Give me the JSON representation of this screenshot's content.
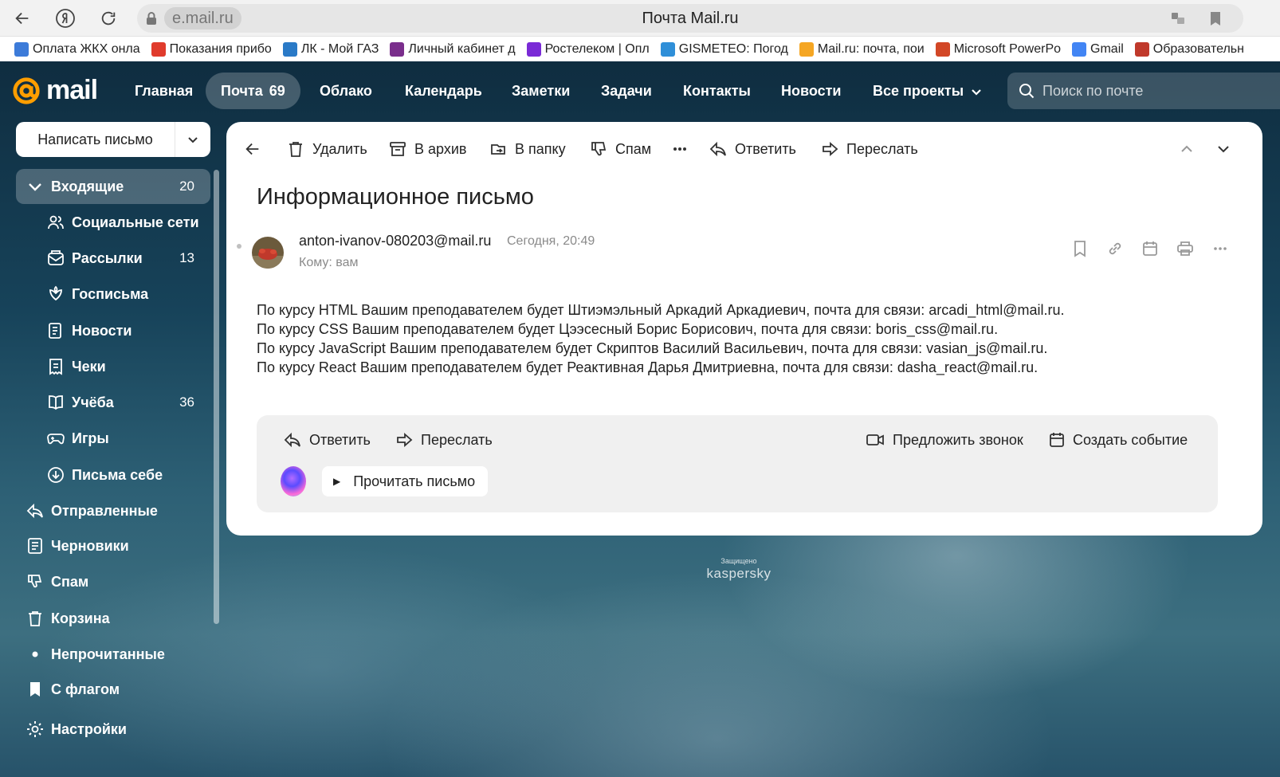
{
  "browser": {
    "url": "e.mail.ru",
    "tab_title": "Почта Mail.ru"
  },
  "bookmarks": [
    {
      "label": "Оплата ЖКХ онла",
      "color": "#3c7bd9"
    },
    {
      "label": "Показания прибо",
      "color": "#e03b2c"
    },
    {
      "label": "ЛК - Мой ГАЗ",
      "color": "#2a7ac7"
    },
    {
      "label": "Личный кабинет д",
      "color": "#7a2e8c"
    },
    {
      "label": "Ростелеком | Опл",
      "color": "#7a2ad6"
    },
    {
      "label": "GISMETEO: Погод",
      "color": "#2f8fd8"
    },
    {
      "label": "Mail.ru: почта, пои",
      "color": "#f5a623"
    },
    {
      "label": "Microsoft PowerPo",
      "color": "#d24726"
    },
    {
      "label": "Gmail",
      "color": "#4285f4"
    },
    {
      "label": "Образовательн",
      "color": "#c0392b"
    }
  ],
  "logo": {
    "text": "mail",
    "accent": "#ff9e00"
  },
  "nav": {
    "home": "Главная",
    "mail": "Почта",
    "mail_count": "69",
    "cloud": "Облако",
    "calendar": "Календарь",
    "notes": "Заметки",
    "tasks": "Задачи",
    "contacts": "Контакты",
    "news": "Новости",
    "all_projects": "Все проекты"
  },
  "search": {
    "placeholder": "Поиск по почте"
  },
  "compose": {
    "label": "Написать письмо"
  },
  "sidebar": {
    "items": [
      {
        "label": "Входящие",
        "count": "20",
        "icon": "chevron-down-icon"
      },
      {
        "label": "Социальные сети",
        "count": "",
        "icon": "people-icon"
      },
      {
        "label": "Рассылки",
        "count": "13",
        "icon": "newsletter-icon"
      },
      {
        "label": "Госписьма",
        "count": "",
        "icon": "emblem-icon"
      },
      {
        "label": "Новости",
        "count": "",
        "icon": "news-icon"
      },
      {
        "label": "Чеки",
        "count": "",
        "icon": "receipt-icon"
      },
      {
        "label": "Учёба",
        "count": "36",
        "icon": "book-icon"
      },
      {
        "label": "Игры",
        "count": "",
        "icon": "gamepad-icon"
      },
      {
        "label": "Письма себе",
        "count": "",
        "icon": "download-icon"
      },
      {
        "label": "Отправленные",
        "count": "",
        "icon": "sent-icon"
      },
      {
        "label": "Черновики",
        "count": "",
        "icon": "draft-icon"
      },
      {
        "label": "Спам",
        "count": "",
        "icon": "spam-icon"
      },
      {
        "label": "Корзина",
        "count": "",
        "icon": "trash-icon"
      },
      {
        "label": "Непрочитанные",
        "count": "",
        "icon": "dot-icon"
      },
      {
        "label": "С флагом",
        "count": "",
        "icon": "flag-icon"
      },
      {
        "label": "Настройки",
        "count": "",
        "icon": "gear-icon"
      }
    ]
  },
  "toolbar": {
    "delete": "Удалить",
    "archive": "В архив",
    "to_folder": "В папку",
    "spam": "Спам",
    "reply": "Ответить",
    "forward": "Переслать"
  },
  "message": {
    "subject": "Информационное письмо",
    "from": "anton-ivanov-080203@mail.ru",
    "date": "Сегодня, 20:49",
    "to": "Кому: вам",
    "body": [
      "По курсу HTML Вашим преподавателем будет Штиэмэльный Аркадий Аркадиевич, почта для связи: arcadi_html@mail.ru.",
      "По курсу CSS Вашим преподавателем будет Цээсесный Борис Борисович, почта для связи: boris_css@mail.ru.",
      "По курсу JavaScript Вашим преподавателем будет Скриптов Василий Васильевич, почта для связи: vasian_js@mail.ru.",
      "По курсу React Вашим преподавателем будет Реактивная Дарья Дмитриевна, почта для связи: dasha_react@mail.ru."
    ]
  },
  "quick_actions": {
    "reply": "Ответить",
    "forward": "Переслать",
    "propose_call": "Предложить звонок",
    "create_event": "Создать событие",
    "read_aloud": "Прочитать письмо"
  },
  "protection": {
    "small": "Защищено",
    "brand": "kaspersky"
  }
}
